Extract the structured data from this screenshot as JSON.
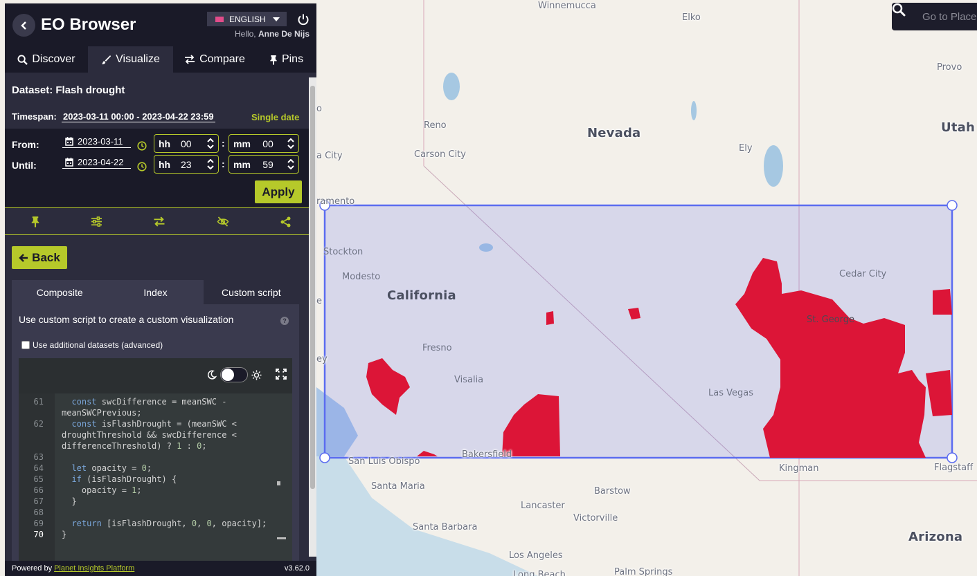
{
  "app": {
    "title": "EO Browser",
    "language": "ENGLISH",
    "greeting_prefix": "Hello,",
    "user_name": "Anne De Nijs"
  },
  "tabs": [
    {
      "label": "Discover",
      "icon": "search-icon"
    },
    {
      "label": "Visualize",
      "icon": "brush-icon",
      "active": true
    },
    {
      "label": "Compare",
      "icon": "compare-icon"
    },
    {
      "label": "Pins",
      "icon": "pin-icon"
    }
  ],
  "visualize": {
    "dataset_label": "Dataset:",
    "dataset_name": "Flash drought",
    "timespan_label": "Timespan:",
    "timespan_value": "2023-03-11 00:00 - 2023-04-22 23:59",
    "single_date": "Single date",
    "from_label": "From:",
    "until_label": "Until:",
    "from_date": "2023-03-11",
    "until_date": "2023-04-22",
    "from_hh": "00",
    "from_mm": "00",
    "until_hh": "23",
    "until_mm": "59",
    "hh_label": "hh",
    "mm_label": "mm",
    "apply_label": "Apply",
    "back_label": "Back",
    "sub_tabs": [
      "Composite",
      "Index",
      "Custom script"
    ],
    "custom_desc": "Use custom script to create a custom visualization",
    "additional_datasets": "Use additional datasets (advanced)"
  },
  "code": {
    "lines": [
      {
        "n": "61",
        "text": "  const swcDifference = meanSWC -"
      },
      {
        "n": "",
        "text": "meanSWCPrevious;"
      },
      {
        "n": "62",
        "text": "  const isFlashDrought = (meanSWC <"
      },
      {
        "n": "",
        "text": "droughtThreshold && swcDifference <"
      },
      {
        "n": "",
        "text": "differenceThreshold) ? 1 : 0;"
      },
      {
        "n": "63",
        "text": ""
      },
      {
        "n": "64",
        "text": "  let opacity = 0;"
      },
      {
        "n": "65",
        "text": "  if (isFlashDrought) {"
      },
      {
        "n": "66",
        "text": "    opacity = 1;"
      },
      {
        "n": "67",
        "text": "  }"
      },
      {
        "n": "68",
        "text": ""
      },
      {
        "n": "69",
        "text": "  return [isFlashDrought, 0, 0, opacity];"
      },
      {
        "n": "70",
        "text": "}"
      }
    ]
  },
  "footer": {
    "powered_by": "Powered by",
    "platform": "Planet Insights Platform",
    "version": "v3.62.0"
  },
  "search": {
    "placeholder": "Go to Place"
  },
  "map": {
    "states": [
      "Nevada",
      "Utah",
      "California",
      "Arizona"
    ],
    "cities": [
      "Winnemucca",
      "Elko",
      "Provo",
      "Reno",
      "Carson City",
      "Ely",
      "Stockton",
      "Modesto",
      "Cedar City",
      "St. George",
      "Fresno",
      "Visalia",
      "Las Vegas",
      "Bakersfield",
      "San Luis Obispo",
      "Kingman",
      "Flagstaff",
      "Santa Maria",
      "Barstow",
      "Lancaster",
      "Victorville",
      "Santa Barbara",
      "Los Angeles",
      "Palm Springs",
      "Long Beach"
    ],
    "edge_fragments": [
      "o",
      "a City",
      "ramento",
      "e",
      "ey"
    ],
    "aoi_color": "#5b6cf0",
    "drought_color": "#dc1537",
    "accent_color": "#b6c92a"
  }
}
